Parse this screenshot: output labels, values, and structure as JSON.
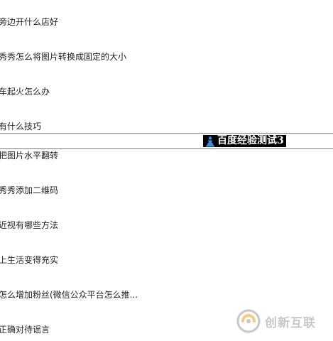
{
  "articles": [
    {
      "title": "旁边开什么店好"
    },
    {
      "title": "秀秀怎么将图片转换成固定的大小"
    },
    {
      "title": "车起火怎么办"
    },
    {
      "title": "有什么技巧"
    },
    {
      "title": "把图片水平翻转"
    },
    {
      "title": "秀秀添加二维码"
    },
    {
      "title": "近视有哪些方法"
    },
    {
      "title": "上生活变得充实"
    },
    {
      "title": "怎么增加粉丝(微信公众平台怎么推..."
    },
    {
      "title": "正确对待谣言"
    }
  ],
  "test_bar": {
    "badge_text": "百度经验测试3",
    "icon": "blue-figure-icon"
  },
  "watermark": {
    "text": "创新互联",
    "icon": "swirl-logo-icon",
    "colors": {
      "accent": "#f0a020",
      "gray": "#9a9a9a"
    }
  }
}
